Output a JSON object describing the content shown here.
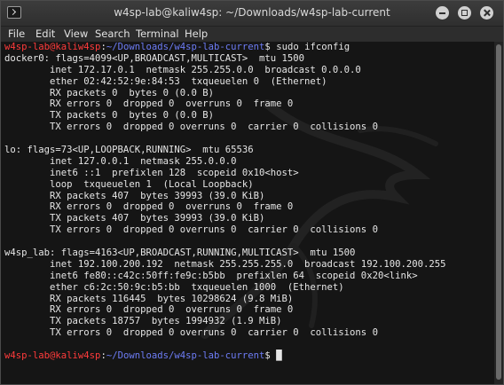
{
  "window": {
    "title": "w4sp-lab@kaliw4sp: ~/Downloads/w4sp-lab-current",
    "icons": {
      "app": "terminal-icon",
      "minimize": "minimize-icon",
      "maximize": "maximize-icon",
      "close": "close-icon"
    }
  },
  "menu": [
    "File",
    "Edit",
    "View",
    "Search",
    "Terminal",
    "Help"
  ],
  "prompt": {
    "user_host": "w4sp-lab@kaliw4sp",
    "separator": ":",
    "path": "~/Downloads/w4sp-lab-current",
    "symbol": "$"
  },
  "command": " sudo ifconfig",
  "output": [
    "docker0: flags=4099<UP,BROADCAST,MULTICAST>  mtu 1500",
    "        inet 172.17.0.1  netmask 255.255.0.0  broadcast 0.0.0.0",
    "        ether 02:42:52:9e:84:53  txqueuelen 0  (Ethernet)",
    "        RX packets 0  bytes 0 (0.0 B)",
    "        RX errors 0  dropped 0  overruns 0  frame 0",
    "        TX packets 0  bytes 0 (0.0 B)",
    "        TX errors 0  dropped 0 overruns 0  carrier 0  collisions 0",
    "",
    "lo: flags=73<UP,LOOPBACK,RUNNING>  mtu 65536",
    "        inet 127.0.0.1  netmask 255.0.0.0",
    "        inet6 ::1  prefixlen 128  scopeid 0x10<host>",
    "        loop  txqueuelen 1  (Local Loopback)",
    "        RX packets 407  bytes 39993 (39.0 KiB)",
    "        RX errors 0  dropped 0  overruns 0  frame 0",
    "        TX packets 407  bytes 39993 (39.0 KiB)",
    "        TX errors 0  dropped 0 overruns 0  carrier 0  collisions 0",
    "",
    "w4sp_lab: flags=4163<UP,BROADCAST,RUNNING,MULTICAST>  mtu 1500",
    "        inet 192.100.200.192  netmask 255.255.255.0  broadcast 192.100.200.255",
    "        inet6 fe80::c42c:50ff:fe9c:b5bb  prefixlen 64  scopeid 0x20<link>",
    "        ether c6:2c:50:9c:b5:bb  txqueuelen 1000  (Ethernet)",
    "        RX packets 116445  bytes 10298624 (9.8 MiB)",
    "        RX errors 0  dropped 0  overruns 0  frame 0",
    "        TX packets 18757  bytes 1994932 (1.9 MiB)",
    "        TX errors 0  dropped 0 overruns 0  carrier 0  collisions 0",
    ""
  ],
  "final_prompt_cursor": "█",
  "colors": {
    "terminal_bg": "#151515",
    "text": "#e6e6e6",
    "prompt_user": "#ff3b3b",
    "prompt_path": "#6d7cf5"
  }
}
